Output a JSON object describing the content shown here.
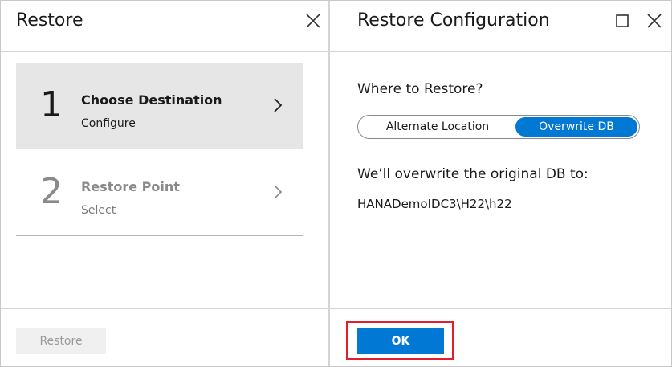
{
  "left_blade": {
    "title": "Restore",
    "steps": [
      {
        "number": "1",
        "title": "Choose Destination",
        "subtitle": "Configure",
        "active": true
      },
      {
        "number": "2",
        "title": "Restore Point",
        "subtitle": "Select",
        "active": false
      }
    ],
    "restore_button_label": "Restore"
  },
  "right_blade": {
    "title": "Restore Configuration",
    "question": "Where to Restore?",
    "options": [
      "Alternate Location",
      "Overwrite DB"
    ],
    "selected_option": "Overwrite DB",
    "message": "We’ll overwrite the original DB to:",
    "db_path": "HANADemoIDC3\\H22\\h22",
    "ok_label": "OK"
  },
  "colors": {
    "accent": "#0078d4",
    "highlight_box": "#e01e2c",
    "active_step_bg": "#e6e6e6"
  },
  "icons": [
    "close-icon",
    "maximize-icon",
    "chevron-right-icon"
  ]
}
